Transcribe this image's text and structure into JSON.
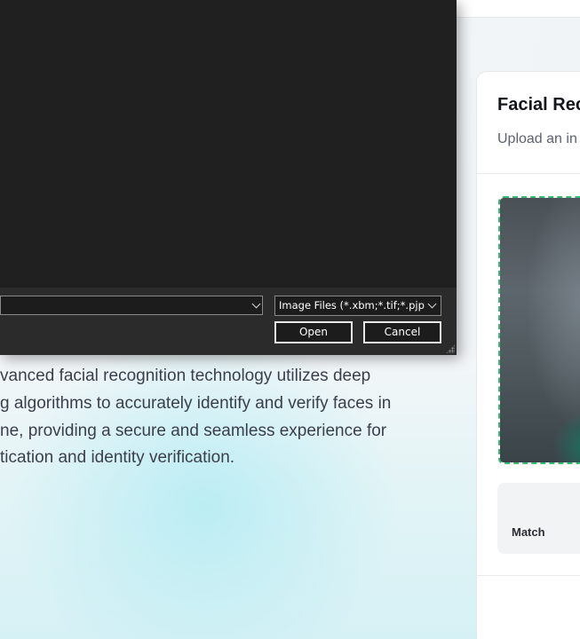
{
  "hero": {
    "description_lines": [
      "vanced facial recognition technology utilizes deep",
      "g algorithms to accurately identify and verify faces in",
      "ne, providing a secure and seamless experience for",
      "tication and identity verification."
    ]
  },
  "card": {
    "title": "Facial Rec",
    "subtitle": "Upload an in",
    "result_label": "Match"
  },
  "file_dialog": {
    "filename_value": "",
    "filetype_selected": "Image Files (*.xbm;*.tif;*.pjp;*.a",
    "open_label": "Open",
    "cancel_label": "Cancel"
  },
  "colors": {
    "dialog_bg": "#2b2b2b",
    "dialog_view_bg": "#202020",
    "upload_border": "#2fbf6e",
    "card_title": "#14161c",
    "body_text": "#3b3f4a"
  },
  "icons": {
    "filename_dropdown": "chevron-down-icon",
    "filetype_dropdown": "chevron-down-icon",
    "resize_grip": "resize-grip-icon"
  }
}
